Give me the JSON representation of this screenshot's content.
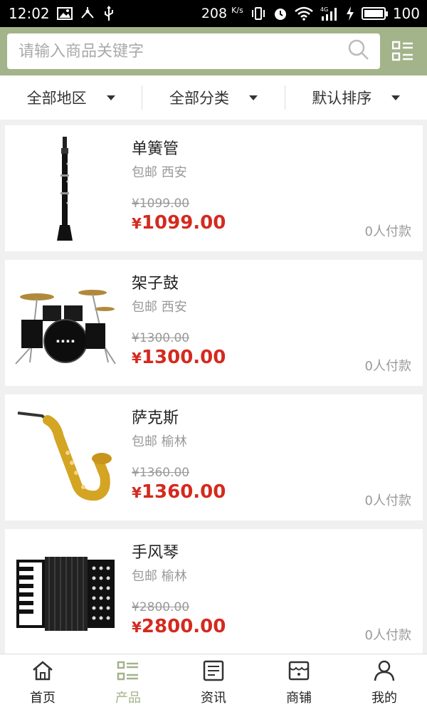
{
  "status_bar": {
    "time": "12:02",
    "speed": "208",
    "speed_unit": "K/s",
    "network": "4G",
    "battery": "100",
    "battery_level_percent": 100
  },
  "search": {
    "placeholder": "请输入商品关键字"
  },
  "filters": [
    {
      "label": "全部地区"
    },
    {
      "label": "全部分类"
    },
    {
      "label": "默认排序"
    }
  ],
  "products": [
    {
      "name": "单簧管",
      "tags": "包邮 西安",
      "original_price": "¥1099.00",
      "price_symbol": "¥",
      "price": "1099.00",
      "paid": "0人付款",
      "image": "clarinet"
    },
    {
      "name": "架子鼓",
      "tags": "包邮 西安",
      "original_price": "¥1300.00",
      "price_symbol": "¥",
      "price": "1300.00",
      "paid": "0人付款",
      "image": "drum-kit"
    },
    {
      "name": "萨克斯",
      "tags": "包邮 榆林",
      "original_price": "¥1360.00",
      "price_symbol": "¥",
      "price": "1360.00",
      "paid": "0人付款",
      "image": "saxophone"
    },
    {
      "name": "手风琴",
      "tags": "包邮 榆林",
      "original_price": "¥2800.00",
      "price_symbol": "¥",
      "price": "2800.00",
      "paid": "0人付款",
      "image": "accordion"
    }
  ],
  "bottom_nav": [
    {
      "label": "首页",
      "icon": "home-icon"
    },
    {
      "label": "产品",
      "icon": "list-icon",
      "active": true
    },
    {
      "label": "资讯",
      "icon": "news-icon"
    },
    {
      "label": "商铺",
      "icon": "shop-icon"
    },
    {
      "label": "我的",
      "icon": "user-icon"
    }
  ],
  "colors": {
    "accent": "#a3b38a",
    "price": "#d42a1f",
    "muted": "#999999"
  }
}
